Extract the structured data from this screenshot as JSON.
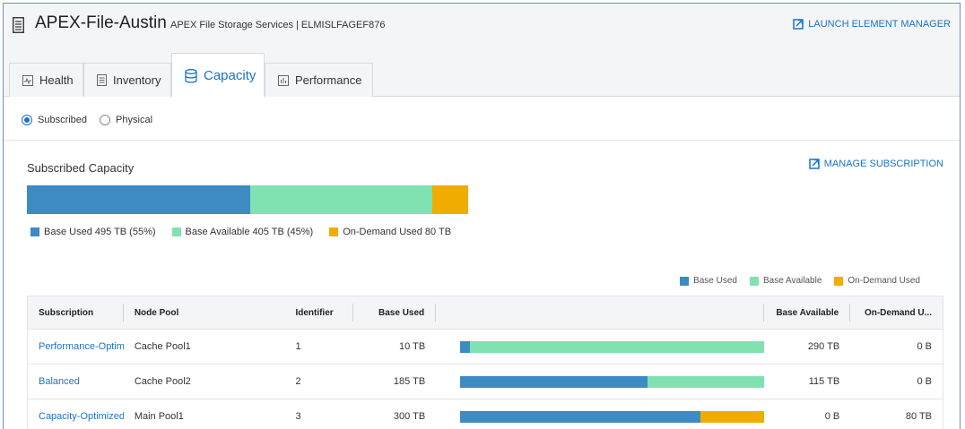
{
  "colors": {
    "base_used": "#3e8ac2",
    "base_available": "#80e2b0",
    "on_demand_used": "#f0ad00",
    "link": "#1a73c9"
  },
  "header": {
    "title": "APEX-File-Austin",
    "subtitle": "APEX File Storage Services | ELMISLFAGEF876",
    "launch_label": "LAUNCH ELEMENT MANAGER",
    "title_icon": "storage-icon",
    "launch_icon": "external-link-icon"
  },
  "tabs": [
    {
      "label": "Health",
      "icon": "pulse-icon",
      "active": false
    },
    {
      "label": "Inventory",
      "icon": "list-icon",
      "active": false
    },
    {
      "label": "Capacity",
      "icon": "database-icon",
      "active": true
    },
    {
      "label": "Performance",
      "icon": "bar-chart-icon",
      "active": false
    }
  ],
  "radios": [
    {
      "label": "Subscribed",
      "selected": true
    },
    {
      "label": "Physical",
      "selected": false
    }
  ],
  "subscribed": {
    "title": "Subscribed Capacity",
    "manage_label": "MANAGE SUBSCRIPTION",
    "legend": [
      {
        "label": "Base Used 495 TB (55%)",
        "key": "base_used"
      },
      {
        "label": "Base Available 405 TB (45%)",
        "key": "base_available"
      },
      {
        "label": "On-Demand Used 80 TB",
        "key": "on_demand_used"
      }
    ],
    "segments_tb": {
      "base_used": 495,
      "base_available": 405,
      "on_demand_used": 80
    }
  },
  "table_legend": [
    "Base Used",
    "Base Available",
    "On-Demand Used"
  ],
  "table": {
    "headers": [
      "Subscription",
      "Node Pool",
      "Identifier",
      "Base Used",
      "",
      "Base Available",
      "On-Demand U..."
    ],
    "rows": [
      {
        "subscription": "Performance-Optimiz",
        "node_pool": "Cache Pool1",
        "identifier": "1",
        "base_used": "10 TB",
        "base_available": "290 TB",
        "on_demand_used": "0 B",
        "bar": {
          "used": 10,
          "available": 290,
          "ondemand": 0
        }
      },
      {
        "subscription": "Balanced",
        "node_pool": "Cache Pool2",
        "identifier": "2",
        "base_used": "185 TB",
        "base_available": "115 TB",
        "on_demand_used": "0 B",
        "bar": {
          "used": 185,
          "available": 115,
          "ondemand": 0
        }
      },
      {
        "subscription": "Capacity-Optimized",
        "node_pool": "Main Pool1",
        "identifier": "3",
        "base_used": "300 TB",
        "base_available": "0 B",
        "on_demand_used": "80 TB",
        "bar": {
          "used": 300,
          "available": 0,
          "ondemand": 80
        }
      }
    ]
  }
}
